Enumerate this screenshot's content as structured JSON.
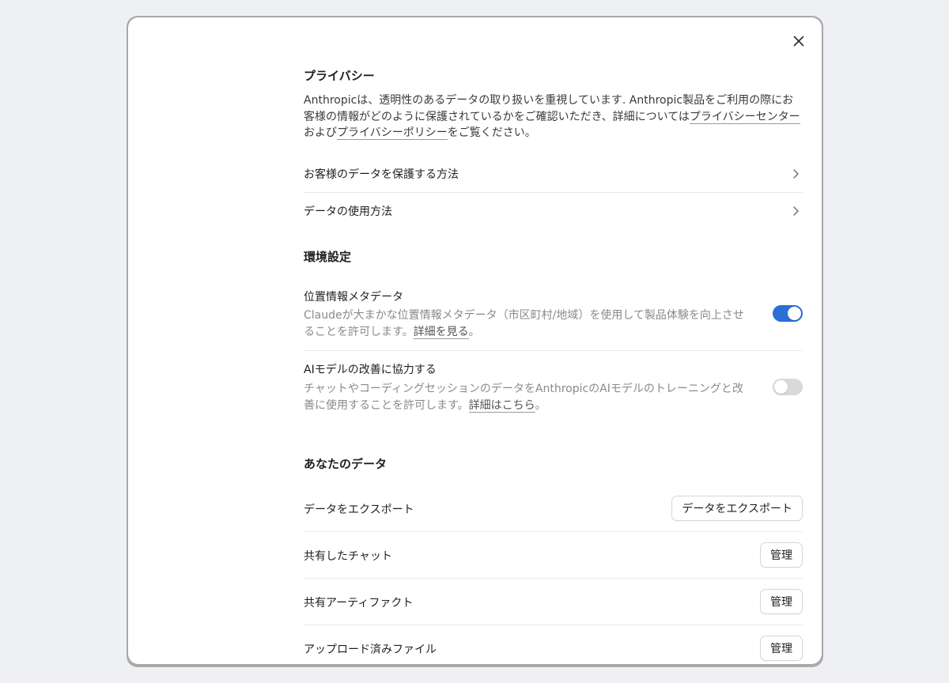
{
  "close": {
    "label": "×"
  },
  "privacy": {
    "title": "プライバシー",
    "intro_before": "Anthropicは、透明性のあるデータの取り扱いを重視しています. Anthropic製品をご利用の際にお客様の情報がどのように保護されているかをご確認いただき、詳細については",
    "link_privacy_center": "プライバシーセンター",
    "intro_middle": "および",
    "link_privacy_policy": "プライバシーポリシー",
    "intro_after": "をご覧ください。",
    "items": [
      {
        "label": "お客様のデータを保護する方法"
      },
      {
        "label": "データの使用方法"
      }
    ]
  },
  "preferences": {
    "title": "環境設定",
    "location": {
      "title": "位置情報メタデータ",
      "desc": "Claudeが大まかな位置情報メタデータ（市区町村/地域）を使用して製品体験を向上させることを許可します。",
      "link": "詳細を見る",
      "link_suffix": "。",
      "enabled": true
    },
    "model_training": {
      "title": "AIモデルの改善に協力する",
      "desc": "チャットやコーディングセッションのデータをAnthropicのAIモデルのトレーニングと改善に使用することを許可します。",
      "link": "詳細はこちら",
      "link_suffix": "。",
      "enabled": false
    }
  },
  "your_data": {
    "title": "あなたのデータ",
    "export": {
      "label": "データをエクスポート",
      "button": "データをエクスポート"
    },
    "shared_chats": {
      "label": "共有したチャット",
      "button": "管理"
    },
    "shared_artifacts": {
      "label": "共有アーティファクト",
      "button": "管理"
    },
    "uploaded_files": {
      "label": "アップロード済みファイル",
      "button": "管理"
    }
  },
  "colors": {
    "toggle_on": "#2a6fd6",
    "toggle_off": "#d9d9d9",
    "page_bg": "#eef0f4"
  },
  "icons": {
    "close": "close-icon",
    "chevron": "chevron-right-icon"
  }
}
